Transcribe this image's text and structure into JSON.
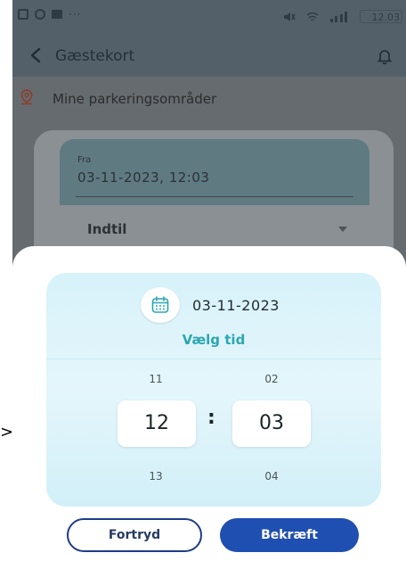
{
  "status_bar": {
    "dots": "···",
    "clock": "12.03"
  },
  "app_bar": {
    "title": "Gæstekort"
  },
  "section": {
    "title": "Mine parkeringsområder"
  },
  "form": {
    "from_label": "Fra",
    "from_value": "03-11-2023, 12:03",
    "until_label": "Indtil"
  },
  "picker": {
    "date": "03-11-2023",
    "choose_time": "Vælg tid",
    "hour_prev": "11",
    "hour_selected": "12",
    "hour_next": "13",
    "minute_prev": "02",
    "minute_selected": "03",
    "minute_next": "04",
    "separator": ":"
  },
  "buttons": {
    "cancel": "Fortryd",
    "confirm": "Bekræft"
  },
  "annotation": {
    "marker": ">"
  },
  "colors": {
    "accent": "#2aa6b2",
    "primary_button": "#1f4fb0",
    "picker_bg": "#dff4fa"
  }
}
